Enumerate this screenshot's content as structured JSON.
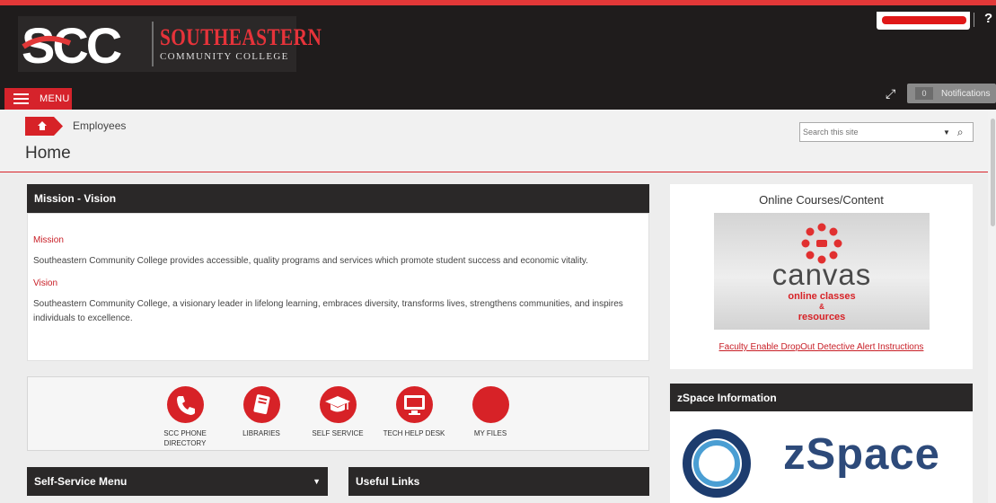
{
  "brand": {
    "logo_letters": "SCC",
    "name": "SOUTHEASTERN",
    "subtitle": "COMMUNITY COLLEGE"
  },
  "top_right": {
    "help_label": "?"
  },
  "menu": {
    "label": "MENU"
  },
  "notifications": {
    "count": "0",
    "label": "Notifications"
  },
  "breadcrumb": {
    "section": "Employees"
  },
  "page": {
    "title": "Home"
  },
  "search": {
    "placeholder": "Search this site"
  },
  "mission_panel": {
    "title": "Mission - Vision",
    "mission_heading": "Mission",
    "mission_text": "Southeastern Community College provides accessible, quality programs and services which promote student success and economic vitality.",
    "vision_heading": "Vision",
    "vision_text": "Southeastern Community College, a visionary leader in lifelong learning, embraces diversity, transforms lives, strengthens communities, and inspires individuals to excellence."
  },
  "quick_links": [
    {
      "label": "SCC PHONE DIRECTORY",
      "icon": "phone-icon"
    },
    {
      "label": "LIBRARIES",
      "icon": "book-icon"
    },
    {
      "label": "SELF SERVICE",
      "icon": "graduation-cap-icon"
    },
    {
      "label": "TECH HELP DESK",
      "icon": "monitor-icon"
    },
    {
      "label": "MY FILES",
      "icon": ""
    }
  ],
  "self_service": {
    "title": "Self-Service Menu"
  },
  "useful_links": {
    "title": "Useful Links"
  },
  "online_courses": {
    "title": "Online Courses/Content",
    "canvas_word": "canvas",
    "canvas_line1": "online classes",
    "canvas_amp": "&",
    "canvas_line2": "resources",
    "link": "Faculty Enable DropOut Detective Alert Instructions"
  },
  "zspace": {
    "title": "zSpace Information",
    "logo_text": "zSpace"
  },
  "colors": {
    "brand_red": "#d72227",
    "dark": "#1f1c1c",
    "panel_head": "#2a2828"
  }
}
